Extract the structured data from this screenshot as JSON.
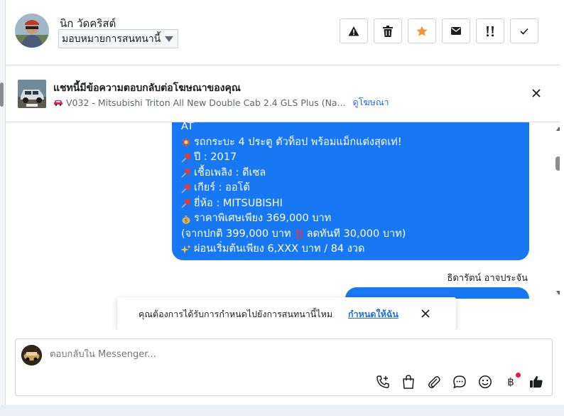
{
  "header": {
    "contact_name": "นิก วัดคริสต์",
    "assign_label": "มอบหมายการสนทนานี้",
    "actions": [
      {
        "name": "report-button",
        "icon": "warning-icon"
      },
      {
        "name": "delete-button",
        "icon": "trash-icon"
      },
      {
        "name": "star-button",
        "icon": "star-icon"
      },
      {
        "name": "mark-unread-button",
        "icon": "envelope-icon"
      },
      {
        "name": "follow-up-button",
        "icon": "exclamation-icon"
      },
      {
        "name": "done-button",
        "icon": "check-icon"
      }
    ],
    "star_color": "#f7923b"
  },
  "ad_banner": {
    "title": "แชทนี้มีข้อความตอบกลับต่อโฆษณาของคุณ",
    "subtitle": "V032 - Mitsubishi Triton All New Double Cab 2.4 GLS Plus (Na...",
    "link": "ดูโฆษณา",
    "car_icon": "car-icon"
  },
  "messages": {
    "bubble_lines": [
      {
        "icon": "",
        "text": "AT"
      },
      {
        "icon": "collision-icon",
        "text": "รถกระบะ 4 ประตู ตัวท็อป พร้อมแม็กแต่งสุดเท่!"
      },
      {
        "icon": "pushpin-icon",
        "text": "ปี : 2017"
      },
      {
        "icon": "pushpin-icon",
        "text": "เชื้อเพลิง : ดีเซล"
      },
      {
        "icon": "pushpin-icon",
        "text": "เกียร์ : ออโต้"
      },
      {
        "icon": "pushpin-icon",
        "text": "ยี่ห้อ : MITSUBISHI"
      },
      {
        "icon": "money-bag-icon",
        "text": "ราคาพิเศษเพียง 369,000 บาท"
      },
      {
        "icon": "",
        "text": "(จากปกติ 399,000 บาท",
        "icon_after": "double-exclamation-icon",
        "text_after": "ลดทันที 30,000 บาท)"
      },
      {
        "icon": "sparkles-icon",
        "text": "ผ่อนเริ่มต้นเพียง 6,XXX บาท / 84 งวด"
      }
    ],
    "sender_name": "ธิดารัตน์ อาจประจัน",
    "bubble_color": "#1877f2"
  },
  "toast": {
    "text": "คุณต้องการได้รับการกำหนดไปยังการสนทนานี้ไหม",
    "link": "กำหนดให้ฉัน"
  },
  "composer": {
    "placeholder": "ตอบกลับใน Messenger...",
    "baht_symbol": "฿",
    "tools": [
      "call-add-icon",
      "shopping-bag-icon",
      "paperclip-icon",
      "chat-bubble-icon",
      "smiley-icon",
      "baht-icon",
      "thumbs-up-icon"
    ]
  }
}
